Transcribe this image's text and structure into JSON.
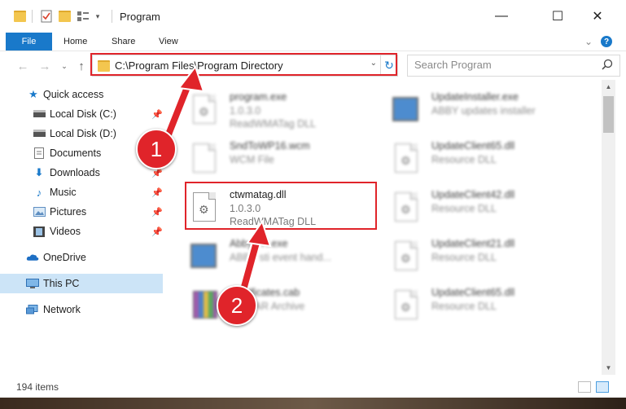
{
  "window": {
    "title": "Program",
    "minimize_glyph": "—",
    "maximize_glyph": "☐",
    "close_glyph": "✕"
  },
  "ribbon": {
    "tabs": [
      "File",
      "Home",
      "Share",
      "View"
    ]
  },
  "address_bar": {
    "path": "C:\\Program Files\\Program Directory"
  },
  "search": {
    "placeholder": "Search Program"
  },
  "sidebar": {
    "items": [
      {
        "label": "Quick access",
        "icon": "star-icon",
        "pinned": false
      },
      {
        "label": "Local Disk (C:)",
        "icon": "drive-icon",
        "pinned": true
      },
      {
        "label": "Local Disk (D:)",
        "icon": "drive-icon",
        "pinned": true
      },
      {
        "label": "Documents",
        "icon": "documents-icon",
        "pinned": true
      },
      {
        "label": "Downloads",
        "icon": "download-icon",
        "pinned": true
      },
      {
        "label": "Music",
        "icon": "music-icon",
        "pinned": true
      },
      {
        "label": "Pictures",
        "icon": "pictures-icon",
        "pinned": true
      },
      {
        "label": "Videos",
        "icon": "videos-icon",
        "pinned": true
      },
      {
        "label": "OneDrive",
        "icon": "onedrive-icon",
        "pinned": false
      },
      {
        "label": "This PC",
        "icon": "computer-icon",
        "pinned": false,
        "selected": true
      },
      {
        "label": "Network",
        "icon": "network-icon",
        "pinned": false
      }
    ]
  },
  "files": [
    {
      "name": "program.exe",
      "line1": "1.0.3.0",
      "line2": "ReadWMATag DLL",
      "icon": "program-icon",
      "blurred": true
    },
    {
      "name": "UpdateInstaller.exe",
      "line1": "ABBY updates installer",
      "line2": "",
      "icon": "exe-icon",
      "blurred": true
    },
    {
      "name": "SndToWP16.wcm",
      "line1": "WCM File",
      "line2": "",
      "icon": "file-icon",
      "blurred": true
    },
    {
      "name": "UpdateClient65.dll",
      "line1": "Resource DLL",
      "line2": "",
      "icon": "dll-icon",
      "blurred": true
    },
    {
      "name": "ctwmatag.dll",
      "line1": "1.0.3.0",
      "line2": "ReadWMATag DLL",
      "icon": "dll-icon",
      "blurred": false
    },
    {
      "name": "UpdateClient42.dll",
      "line1": "Resource DLL",
      "line2": "",
      "icon": "dll-icon",
      "blurred": true
    },
    {
      "name": "AbbySTI.exe",
      "line1": "ABBY sti event hand...",
      "line2": "",
      "icon": "exe-icon",
      "blurred": true
    },
    {
      "name": "UpdateClient21.dll",
      "line1": "Resource DLL",
      "line2": "",
      "icon": "dll-icon",
      "blurred": true
    },
    {
      "name": "Certificates.cab",
      "line1": "WinRAR Archive",
      "line2": "",
      "icon": "archive-icon",
      "blurred": true
    },
    {
      "name": "UpdateClient65.dll",
      "line1": "Resource DLL",
      "line2": "",
      "icon": "dll-icon",
      "blurred": true
    }
  ],
  "status": {
    "items_count": "194 items"
  },
  "annotations": {
    "step1": "1",
    "step2": "2"
  },
  "colors": {
    "accent": "#1979ca",
    "highlight": "#e0242a",
    "selection": "#cce4f7"
  }
}
